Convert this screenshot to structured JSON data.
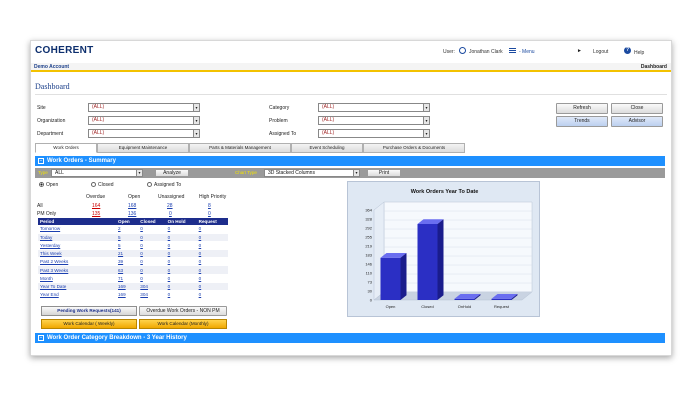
{
  "header": {
    "logo_text": "COHERENT",
    "user_label": "User:",
    "user_name": "Jonathan Clark",
    "menu_label": "- Menu",
    "logout_label": "Logout",
    "help_label": "Help",
    "account_name": "Demo Account",
    "breadcrumb": "Dashboard"
  },
  "page_title": "Dashboard",
  "filters": {
    "site_label": "Site",
    "site_value": "(ALL)",
    "org_label": "Organization",
    "org_value": "(ALL)",
    "dept_label": "Department",
    "dept_value": "(ALL)",
    "category_label": "Category",
    "category_value": "(ALL)",
    "problem_label": "Problem",
    "problem_value": "(ALL)",
    "assigned_label": "Assigned To",
    "assigned_value": "(ALL)"
  },
  "actions": {
    "refresh": "Refresh",
    "close": "Close",
    "trends": "Trends",
    "advisor": "Advisor"
  },
  "tabs": [
    "Work Orders",
    "Equipment Maintenance",
    "Parts & Materials Management",
    "Event Scheduling",
    "Purchase Orders & Documents"
  ],
  "summary": {
    "title": "Work Orders - Summary",
    "type_label": "Type",
    "type_value": "ALL",
    "analyze": "Analyze",
    "chart_type_label": "Chart Type",
    "chart_type_value": "3D Stacked Columns",
    "print": "Print",
    "radio_open": "Open",
    "radio_closed": "Closed",
    "radio_assigned": "Assigned To",
    "cols": [
      "Overdue",
      "Open",
      "Unassigned",
      "High Priority"
    ],
    "rows": [
      {
        "label": "All",
        "overdue": "164",
        "open": "168",
        "unassigned": "28",
        "high": "8"
      },
      {
        "label": "PM Only",
        "overdue": "135",
        "open": "136",
        "unassigned": "0",
        "high": "0"
      }
    ],
    "period_headers": [
      "Period",
      "Open",
      "Closed",
      "On Hold",
      "Request"
    ],
    "periods": [
      [
        "Tomorrow",
        "2",
        "0",
        "0",
        "0"
      ],
      [
        "Today",
        "5",
        "0",
        "0",
        "0"
      ],
      [
        "Yesterday",
        "5",
        "0",
        "0",
        "0"
      ],
      [
        "This Week",
        "21",
        "0",
        "0",
        "0"
      ],
      [
        "Past 2 Weeks",
        "39",
        "0",
        "0",
        "0"
      ],
      [
        "Past 3 Weeks",
        "63",
        "0",
        "0",
        "0"
      ],
      [
        "Month",
        "71",
        "0",
        "0",
        "0"
      ],
      [
        "Year To Date",
        "169",
        "304",
        "0",
        "0"
      ],
      [
        "Year End",
        "169",
        "304",
        "0",
        "0"
      ]
    ],
    "pending_button": "Pending Work Requests(141)",
    "overdue_nonpm_button": "Overdue Work Orders - NON PM",
    "weekly_button": "Work Calendar ( Weekly)",
    "monthly_button": "Work Calendar (Monthly)"
  },
  "chart_data": {
    "type": "bar",
    "title": "Work Orders Year To Date",
    "categories": [
      "Open",
      "Closed",
      "OnHold",
      "Request"
    ],
    "values": [
      169,
      304,
      0,
      0
    ],
    "ylim": [
      0,
      360
    ],
    "yticks": [
      "0",
      "30",
      "73",
      "110",
      "146",
      "183",
      "219",
      "255",
      "292",
      "328",
      "364"
    ],
    "bar_color": "#2b2fc4",
    "grid": true
  },
  "footer_section": {
    "title": "Work Order Category Breakdown - 3 Year History"
  }
}
